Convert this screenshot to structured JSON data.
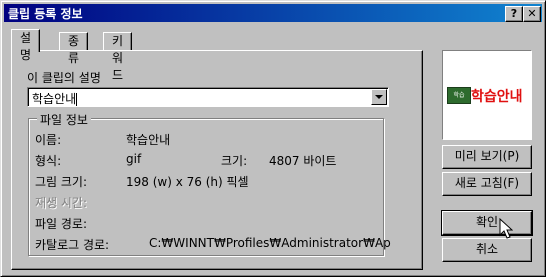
{
  "window": {
    "title": "클립 등록 정보",
    "help_btn": "?",
    "close_btn": "✕"
  },
  "tabs": [
    {
      "label": "설명",
      "active": true
    },
    {
      "label": "종류",
      "active": false
    },
    {
      "label": "키워드",
      "active": false
    }
  ],
  "description": {
    "label": "이 클립의 설명",
    "value": "학습안내"
  },
  "file_info": {
    "title": "파일 정보",
    "name_label": "이름:",
    "name_value": "학습안내",
    "format_label": "형식:",
    "format_value": "gif",
    "size_label": "크기:",
    "size_value": "4807 바이트",
    "dims_label": "그림 크기:",
    "dims_value": "198 (w) x 76 (h) 픽셀",
    "playtime_label": "재생 시간:",
    "path_label": "파일 경로:",
    "catalog_label": "카탈로그 경로:",
    "catalog_value": "C:₩WINNT₩Profiles₩Administrator₩Ap"
  },
  "preview": {
    "logo_text": "학습안내",
    "board_text": "학습"
  },
  "buttons": {
    "preview": "미리 보기(P)",
    "refresh": "새로 고침(F)",
    "ok": "확인",
    "cancel": "취소"
  }
}
